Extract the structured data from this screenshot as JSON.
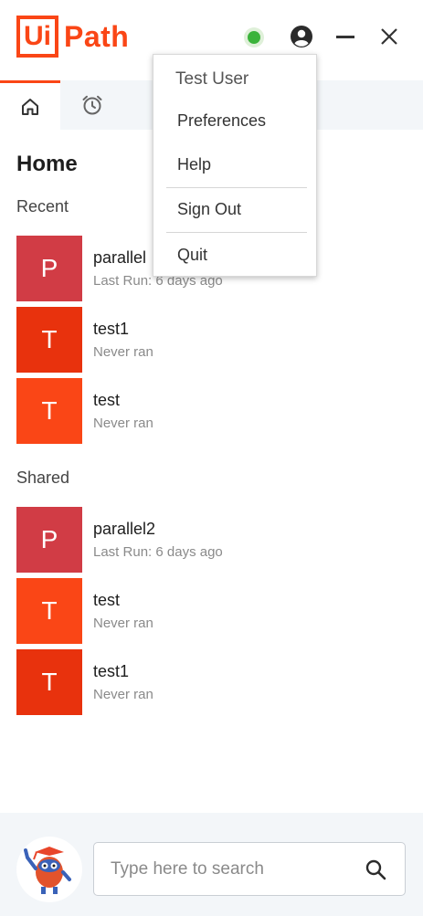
{
  "header": {
    "logo_box": "Ui",
    "logo_text": "Path"
  },
  "colors": {
    "brand": "#fa4616",
    "tile_p": "#d13c45",
    "tile_t_dark": "#e8320d",
    "tile_t_light": "#fa4616",
    "status_online": "#3bb33b"
  },
  "icons": {
    "status": "status-online-icon",
    "user": "user-account-icon",
    "minimize": "minimize-icon",
    "close": "close-icon",
    "home": "home-icon",
    "schedule": "alarm-clock-icon",
    "search": "search-icon",
    "assistant": "robot-avatar-icon"
  },
  "main": {
    "title": "Home",
    "recent_label": "Recent",
    "shared_label": "Shared",
    "recent": [
      {
        "letter": "P",
        "name": "parallel",
        "sub": "Last Run: 6 days ago"
      },
      {
        "letter": "T",
        "name": "test1",
        "sub": "Never ran"
      },
      {
        "letter": "T",
        "name": "test",
        "sub": "Never ran"
      }
    ],
    "shared": [
      {
        "letter": "P",
        "name": "parallel2",
        "sub": "Last Run: 6 days ago"
      },
      {
        "letter": "T",
        "name": "test",
        "sub": "Never ran"
      },
      {
        "letter": "T",
        "name": "test1",
        "sub": "Never ran"
      }
    ]
  },
  "menu": {
    "user_name": "Test User",
    "preferences": "Preferences",
    "help": "Help",
    "sign_out": "Sign Out",
    "quit": "Quit"
  },
  "search": {
    "placeholder": "Type here to search",
    "value": ""
  }
}
